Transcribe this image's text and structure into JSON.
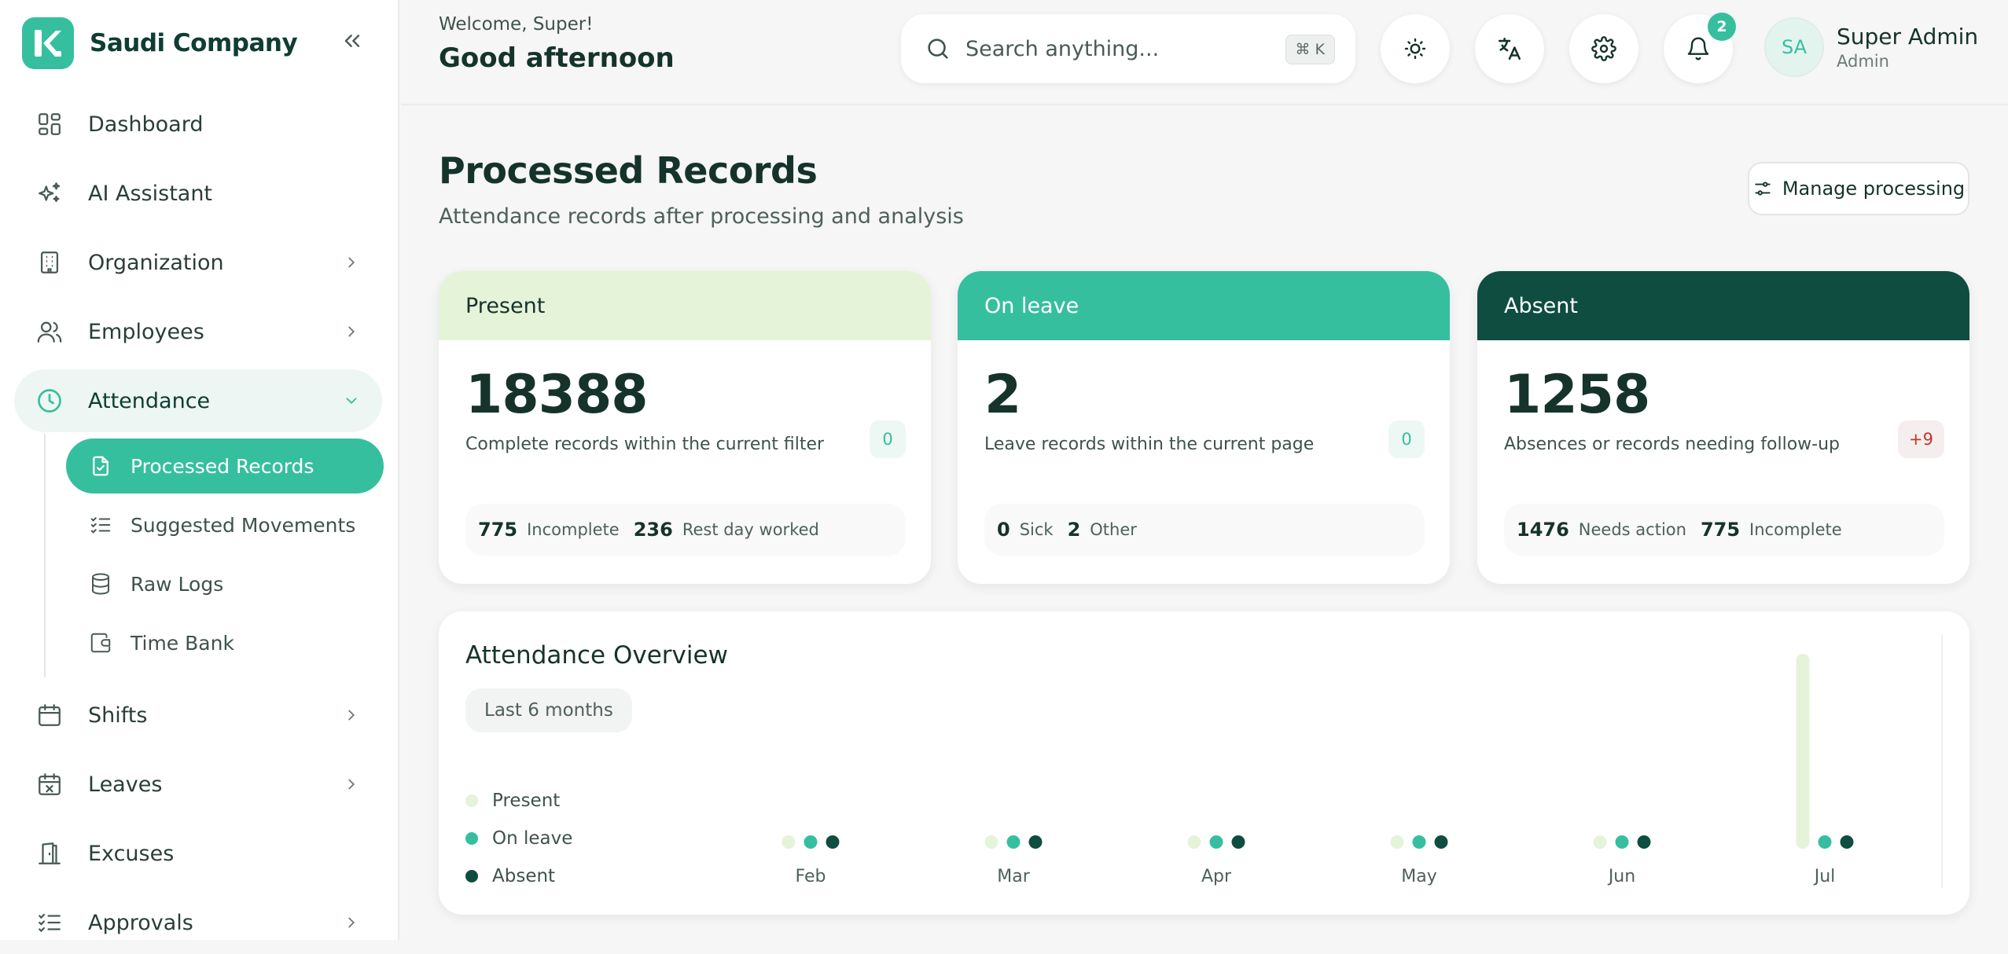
{
  "brand": {
    "name": "Saudi Company"
  },
  "colors": {
    "accent": "#36bf9f",
    "dark": "#0f4d40",
    "light": "#e5f3d9",
    "absent_chip_bg": "#f5eeee",
    "absent_chip_text": "#c0392b"
  },
  "sidebar": {
    "items": [
      {
        "label": "Dashboard",
        "icon": "dashboard-icon"
      },
      {
        "label": "AI Assistant",
        "icon": "sparkles-icon"
      },
      {
        "label": "Organization",
        "icon": "building-icon"
      },
      {
        "label": "Employees",
        "icon": "users-icon"
      },
      {
        "label": "Attendance",
        "icon": "clock-icon"
      },
      {
        "label": "Shifts",
        "icon": "calendar-icon"
      },
      {
        "label": "Leaves",
        "icon": "calendar-x-icon"
      },
      {
        "label": "Excuses",
        "icon": "door-icon"
      },
      {
        "label": "Approvals",
        "icon": "list-check-icon"
      }
    ],
    "attendance_sub": [
      {
        "label": "Processed Records",
        "icon": "file-check-icon"
      },
      {
        "label": "Suggested Movements",
        "icon": "list-check-icon"
      },
      {
        "label": "Raw Logs",
        "icon": "database-icon"
      },
      {
        "label": "Time Bank",
        "icon": "wallet-icon"
      }
    ]
  },
  "header": {
    "welcome": "Welcome, Super!",
    "greeting": "Good afternoon",
    "search_placeholder": "Search anything...",
    "search_shortcut": "⌘ K",
    "notifications_count": "2",
    "user": {
      "initials": "SA",
      "name": "Super Admin",
      "role": "Admin"
    }
  },
  "main": {
    "title": "Processed Records",
    "subtitle": "Attendance records after processing and analysis",
    "manage_button": "Manage processing",
    "cards": [
      {
        "title": "Present",
        "value": "18388",
        "description": "Complete records within the current filter",
        "chip": "0",
        "stats": [
          {
            "n": "775",
            "label": "Incomplete"
          },
          {
            "n": "236",
            "label": "Rest day worked"
          }
        ]
      },
      {
        "title": "On leave",
        "value": "2",
        "description": "Leave records within the current page",
        "chip": "0",
        "stats": [
          {
            "n": "0",
            "label": "Sick"
          },
          {
            "n": "2",
            "label": "Other"
          }
        ]
      },
      {
        "title": "Absent",
        "value": "1258",
        "description": "Absences or records needing follow-up",
        "chip": "+9",
        "stats": [
          {
            "n": "1476",
            "label": "Needs action"
          },
          {
            "n": "775",
            "label": "Incomplete"
          }
        ]
      }
    ],
    "chart": {
      "title": "Attendance Overview",
      "range": "Last 6 months"
    }
  },
  "chart_data": {
    "type": "bar",
    "categories": [
      "Feb",
      "Mar",
      "Apr",
      "May",
      "Jun",
      "Jul"
    ],
    "series": [
      {
        "name": "Present",
        "values": [
          0,
          0,
          0,
          0,
          0,
          18388
        ]
      },
      {
        "name": "On leave",
        "values": [
          0,
          0,
          0,
          0,
          0,
          2
        ]
      },
      {
        "name": "Absent",
        "values": [
          0,
          0,
          0,
          0,
          0,
          1258
        ]
      }
    ],
    "bar_colors": [
      "#e5f3d9",
      "#36bf9f",
      "#0f4d40"
    ],
    "legend": "left",
    "grid": false
  }
}
